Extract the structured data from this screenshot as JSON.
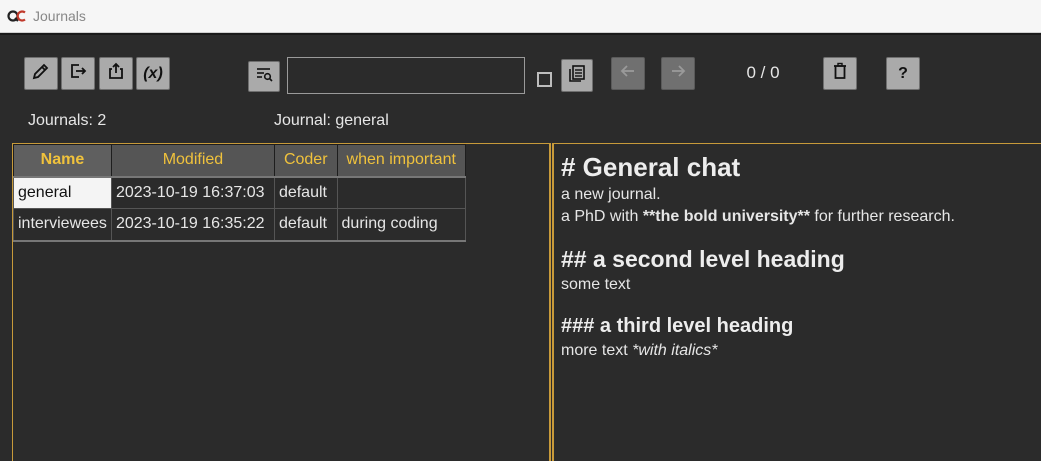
{
  "window": {
    "title": "Journals"
  },
  "toolbar": {
    "variable_label": "(x)",
    "help_label": "?",
    "search": {
      "value": "",
      "placeholder": ""
    },
    "counter": "0 / 0"
  },
  "status": {
    "journals_count": "Journals: 2",
    "current_journal": "Journal: general"
  },
  "table": {
    "headers": [
      "Name",
      "Modified",
      "Coder",
      "when important"
    ],
    "rows": [
      {
        "name": "general",
        "modified": "2023-10-19 16:37:03",
        "coder": "default",
        "when": ""
      },
      {
        "name": "interviewees",
        "modified": "2023-10-19 16:35:22",
        "coder": "default",
        "when": "during coding"
      }
    ]
  },
  "preview": {
    "h1": "# General chat",
    "p1": "a new journal.",
    "p2_pre": "a PhD with ",
    "p2_bold": "**the bold university**",
    "p2_post": " for further research.",
    "h2": "## a second level heading",
    "p3": "some text",
    "h3": "### a third level heading",
    "p4_pre": "more text ",
    "p4_ital": "*with italics*"
  },
  "colors": {
    "accent": "#f0c23c",
    "border": "#c79a3a",
    "background": "#2b2b2b",
    "button": "#aaaaaa"
  },
  "icons": [
    "edit-icon",
    "export-icon",
    "share-icon",
    "variable-icon",
    "search-filter-icon",
    "copy-all-icon",
    "arrow-left-icon",
    "arrow-right-icon",
    "trash-icon",
    "help-icon"
  ]
}
